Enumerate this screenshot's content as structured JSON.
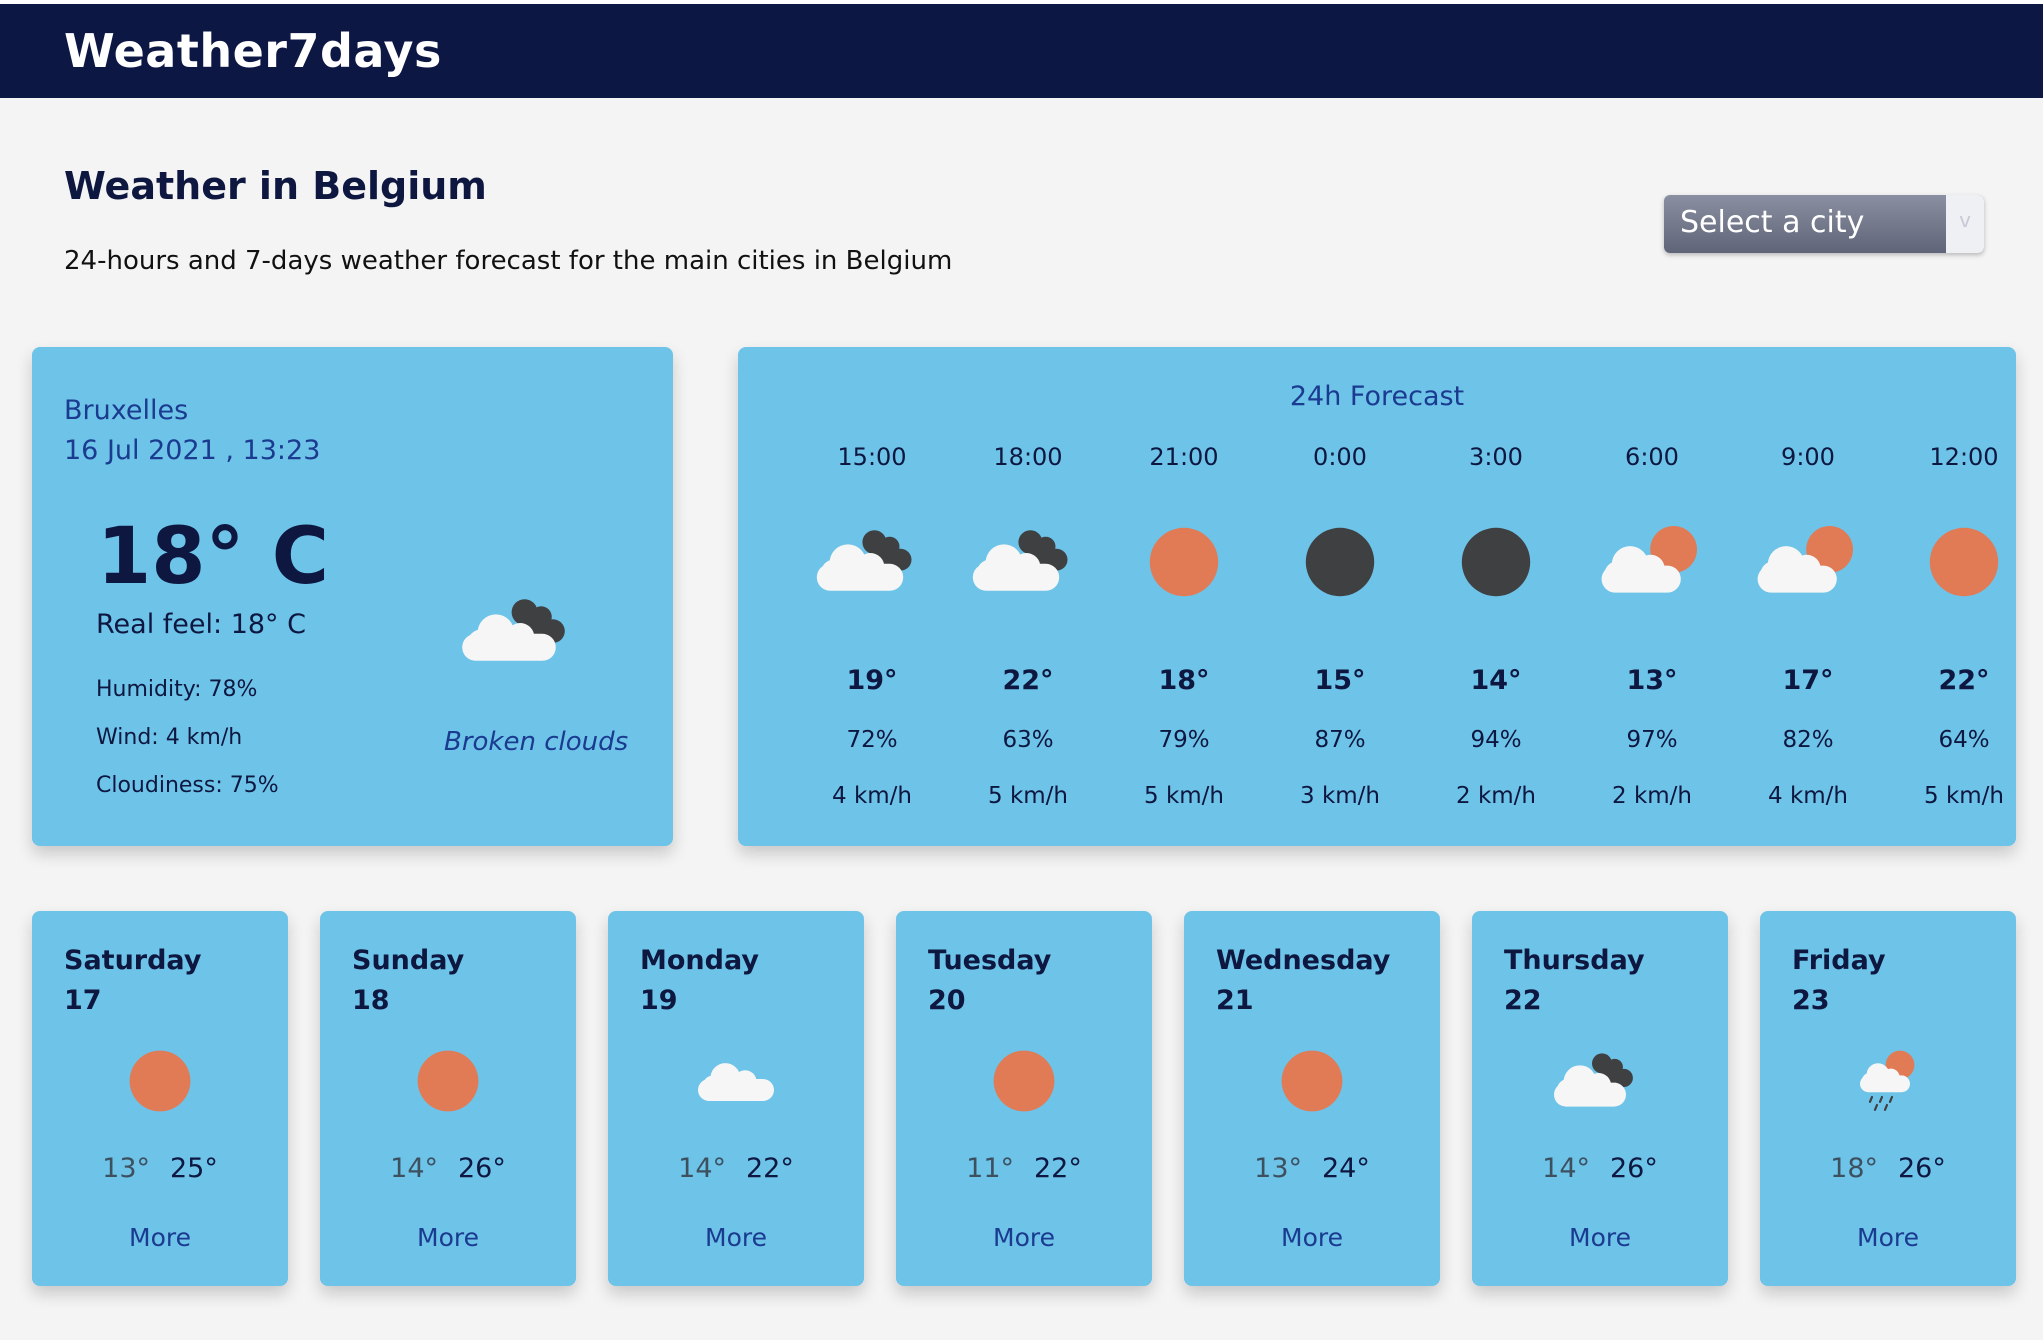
{
  "app": {
    "brand": "Weather7days"
  },
  "header": {
    "title": "Weather in Belgium",
    "subtitle": "24-hours and 7-days weather forecast for the main cities in Belgium"
  },
  "city_select": {
    "label": "Select a city",
    "arrow": "v"
  },
  "current": {
    "city": "Bruxelles",
    "datetime": "16 Jul 2021 , 13:23",
    "temperature": "18° C",
    "real_feel": "Real feel: 18° C",
    "humidity": "Humidity: 78%",
    "wind": "Wind: 4 km/h",
    "cloudiness": "Cloudiness: 75%",
    "condition": "Broken clouds",
    "icon": "broken-clouds-icon"
  },
  "forecast24": {
    "title": "24h Forecast",
    "hours": [
      {
        "time": "15:00",
        "icon": "broken-clouds-icon",
        "temp": "19°",
        "humidity": "72%",
        "wind": "4 km/h"
      },
      {
        "time": "18:00",
        "icon": "broken-clouds-icon",
        "temp": "22°",
        "humidity": "63%",
        "wind": "5 km/h"
      },
      {
        "time": "21:00",
        "icon": "sun-icon",
        "temp": "18°",
        "humidity": "79%",
        "wind": "5 km/h"
      },
      {
        "time": "0:00",
        "icon": "moon-icon",
        "temp": "15°",
        "humidity": "87%",
        "wind": "3 km/h"
      },
      {
        "time": "3:00",
        "icon": "moon-icon",
        "temp": "14°",
        "humidity": "94%",
        "wind": "2 km/h"
      },
      {
        "time": "6:00",
        "icon": "partly-cloudy-icon",
        "temp": "13°",
        "humidity": "97%",
        "wind": "2 km/h"
      },
      {
        "time": "9:00",
        "icon": "partly-cloudy-icon",
        "temp": "17°",
        "humidity": "82%",
        "wind": "4 km/h"
      },
      {
        "time": "12:00",
        "icon": "sun-icon",
        "temp": "22°",
        "humidity": "64%",
        "wind": "5 km/h"
      }
    ]
  },
  "days": [
    {
      "name": "Saturday",
      "date": "17",
      "icon": "sun-icon",
      "min": "13°",
      "max": "25°",
      "more": "More"
    },
    {
      "name": "Sunday",
      "date": "18",
      "icon": "sun-icon",
      "min": "14°",
      "max": "26°",
      "more": "More"
    },
    {
      "name": "Monday",
      "date": "19",
      "icon": "cloud-icon",
      "min": "14°",
      "max": "22°",
      "more": "More"
    },
    {
      "name": "Tuesday",
      "date": "20",
      "icon": "sun-icon",
      "min": "11°",
      "max": "22°",
      "more": "More"
    },
    {
      "name": "Wednesday",
      "date": "21",
      "icon": "sun-icon",
      "min": "13°",
      "max": "24°",
      "more": "More"
    },
    {
      "name": "Thursday",
      "date": "22",
      "icon": "broken-clouds-icon",
      "min": "14°",
      "max": "26°",
      "more": "More"
    },
    {
      "name": "Friday",
      "date": "23",
      "icon": "rain-icon",
      "min": "18°",
      "max": "26°",
      "more": "More"
    }
  ],
  "colors": {
    "navbar": "#0d1744",
    "card": "#6ec3e8",
    "sun": "#e07b55",
    "moon": "#3f4042",
    "dark_cloud": "#3f4042",
    "white_cloud": "#f6f6f6",
    "accent_text": "#1a3b8f"
  }
}
